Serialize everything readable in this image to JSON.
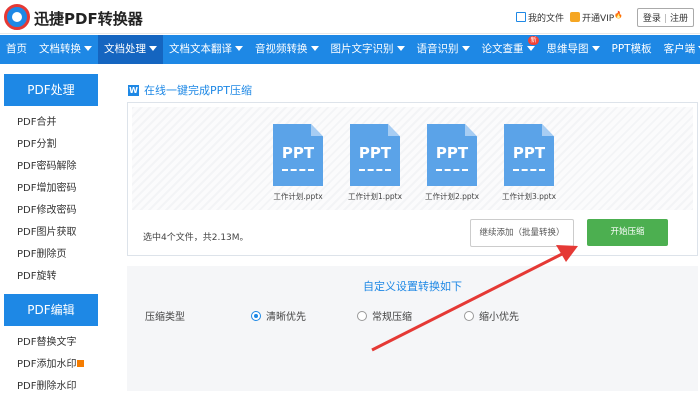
{
  "header": {
    "brand": "迅捷PDF转换器",
    "my_files": "我的文件",
    "vip": "开通VIP",
    "vip_tag": "🔥",
    "login": "登录",
    "separator": "|",
    "register": "注册"
  },
  "nav": {
    "items": [
      {
        "label": "首页",
        "caret": false
      },
      {
        "label": "文档转换",
        "caret": true
      },
      {
        "label": "文档处理",
        "caret": true,
        "active": true
      },
      {
        "label": "文档文本翻译",
        "caret": true
      },
      {
        "label": "音视频转换",
        "caret": true
      },
      {
        "label": "图片文字识别",
        "caret": true
      },
      {
        "label": "语音识别",
        "caret": true
      },
      {
        "label": "论文查重",
        "caret": true,
        "badge": "新"
      },
      {
        "label": "思维导图",
        "caret": true
      },
      {
        "label": "PPT模板",
        "caret": false
      },
      {
        "label": "客户端",
        "caret": true
      }
    ]
  },
  "sidebar": {
    "group1": {
      "title": "PDF处理",
      "items": [
        "PDF合并",
        "PDF分割",
        "PDF密码解除",
        "PDF增加密码",
        "PDF修改密码",
        "PDF图片获取",
        "PDF删除页",
        "PDF旋转"
      ]
    },
    "group2": {
      "title": "PDF编辑",
      "items": [
        "PDF替换文字",
        "PDF添加水印",
        "PDF删除水印"
      ]
    }
  },
  "main": {
    "title_icon": "W",
    "title": "在线一键完成PPT压缩",
    "file_type_label": "PPT",
    "files": [
      "工作计划.pptx",
      "工作计划1.pptx",
      "工作计划2.pptx",
      "工作计划3.pptx"
    ],
    "summary": "选中4个文件，共2.13M。",
    "add_button": "继续添加（批量转换）",
    "start_button": "开始压缩"
  },
  "settings": {
    "title": "自定义设置转换如下",
    "type_label": "压缩类型",
    "options": [
      {
        "label": "清晰优先",
        "checked": true
      },
      {
        "label": "常规压缩",
        "checked": false
      },
      {
        "label": "缩小优先",
        "checked": false
      }
    ]
  },
  "colors": {
    "brand_blue": "#1e88e5",
    "start_green": "#4caf50",
    "arrow_red": "#e53935"
  }
}
